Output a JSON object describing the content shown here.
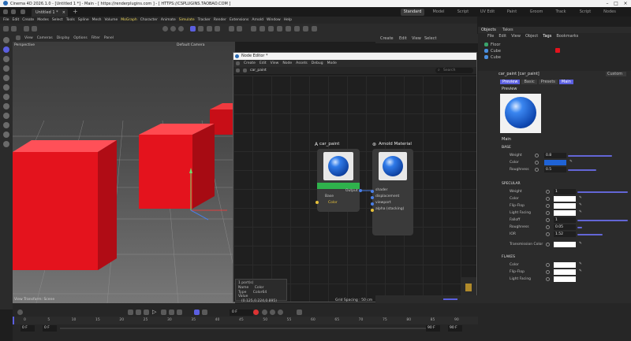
{
  "window": {
    "title": "Cinema 4D 2026.1.0 - [Untitled 1 *] - Main - [ https://renderplugins.com ] - [ HTTPS://CSPLUGINS.TAOBAO.COM ]"
  },
  "doc_tab": "Untitled 1 *",
  "layouts": [
    "Standard",
    "Model",
    "Script",
    "UV Edit",
    "Paint",
    "Groom",
    "Track",
    "Script",
    "Nodes"
  ],
  "menu": [
    "File",
    "Edit",
    "Create",
    "Modes",
    "Select",
    "Tools",
    "Spline",
    "Mesh",
    "Volume",
    "MoGraph",
    "Character",
    "Animate",
    "Simulate",
    "Tracker",
    "Render",
    "Extensions",
    "Arnold",
    "Window",
    "Help"
  ],
  "viewport": {
    "menu": [
      "View",
      "Cameras",
      "Display",
      "Options",
      "Filter",
      "Panel"
    ],
    "label": "Perspective",
    "camera": "Default Camera",
    "status": "View Transform: Scene",
    "grid": "Grid Spacing : 50 cm"
  },
  "node_editor": {
    "title": "Node Editor *",
    "menu": [
      "Create",
      "Edit",
      "View",
      "Node",
      "Assets",
      "Debug",
      "Mode"
    ],
    "breadcrumb": "car_paint",
    "search_placeholder": "Search",
    "node_carpaint": {
      "title": "car_paint",
      "port_base": "Base",
      "port_color": "Color"
    },
    "node_material": {
      "title": "Arnold Material",
      "output": "Output",
      "inputs": [
        "shader",
        "displacement",
        "viewport",
        "alpha (stacking)"
      ]
    },
    "info": {
      "count": "1 port(s)",
      "name_label": "Name",
      "name": "Color",
      "type_label": "Type",
      "type": "Color64",
      "value_label": "Value",
      "value": "(0.125,0.224,0.895)"
    }
  },
  "objects_panel": {
    "tabs": [
      "Objects",
      "Takes"
    ],
    "menu": [
      "File",
      "Edit",
      "View",
      "Object",
      "Tags",
      "Bookmarks"
    ],
    "items": [
      "Floor",
      "Cube",
      "Cube"
    ]
  },
  "attributes": {
    "header": "car_paint [car_paint]",
    "custom": "Custom",
    "tabs": [
      "Preview",
      "Basic",
      "Presets",
      "Main"
    ],
    "preview_label": "Preview",
    "main_label": "Main",
    "sections": {
      "base": "BASE",
      "specular": "SPECULAR",
      "flakes": "FLAKES"
    },
    "base_props": [
      {
        "label": "Weight",
        "value": "0.8"
      },
      {
        "label": "Color",
        "value": ""
      },
      {
        "label": "Roughness",
        "value": "0.5"
      }
    ],
    "specular_props": [
      {
        "label": "Weight",
        "value": "1"
      },
      {
        "label": "Color",
        "value": ""
      },
      {
        "label": "Flip-Flop",
        "value": ""
      },
      {
        "label": "Light Facing",
        "value": ""
      },
      {
        "label": "Falloff",
        "value": "1"
      },
      {
        "label": "Roughness",
        "value": "0.05"
      },
      {
        "label": "IOR",
        "value": "1.52"
      },
      {
        "label": "Transmission Color",
        "value": ""
      }
    ],
    "flakes_props": [
      {
        "label": "Color",
        "value": ""
      },
      {
        "label": "Flip-Flop",
        "value": ""
      },
      {
        "label": "Light Facing",
        "value": ""
      }
    ],
    "color_swatch": "#1f63d6"
  },
  "timeline": {
    "current_frame": "0 F",
    "start": "0 F",
    "start2": "0 F",
    "end": "90 F",
    "end2": "90 F",
    "ticks": [
      "0",
      "5",
      "10",
      "15",
      "20",
      "25",
      "30",
      "35",
      "40",
      "45",
      "50",
      "55",
      "60",
      "65",
      "70",
      "75",
      "80",
      "85",
      "90"
    ]
  },
  "colors": {
    "accent": "#5b5fe0",
    "green_node": "#2fb24c",
    "red_cube": "#e4131d"
  }
}
